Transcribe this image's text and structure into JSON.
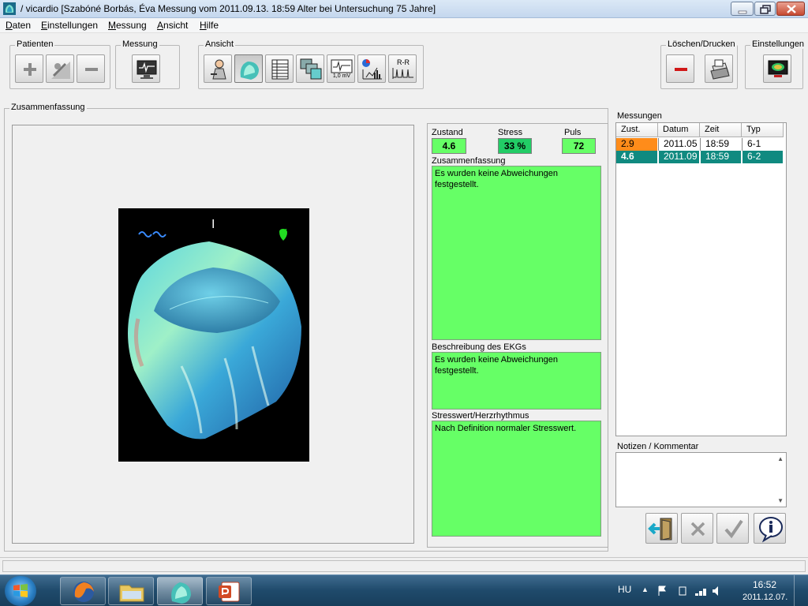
{
  "window": {
    "title": "/ vicardio [Szabóné Borbás, Éva Messung vom 2011.09.13. 18:59 Alter bei Untersuchung 75 Jahre]"
  },
  "menu": [
    "Daten",
    "Einstellungen",
    "Messung",
    "Ansicht",
    "Hilfe"
  ],
  "toolbar": {
    "patienten": {
      "label": "Patienten",
      "buttons": [
        "add-patient",
        "edit-patient",
        "remove-patient"
      ]
    },
    "messung": {
      "label": "Messung",
      "buttons": [
        "ecg-monitor"
      ]
    },
    "ansicht": {
      "label": "Ansicht",
      "buttons": [
        "patient-view",
        "3d-heart-view",
        "table-view",
        "multi-view",
        "ecg-1mv-view",
        "chart-view",
        "rr-interval-view"
      ],
      "ecg_scale": "1,0 mV",
      "rr_label": "R-R"
    },
    "loeschen": {
      "label": "Löschen/Drucken",
      "buttons": [
        "delete",
        "print"
      ]
    },
    "einstellungen": {
      "label": "Einstellungen",
      "buttons": [
        "monitor-settings"
      ]
    }
  },
  "main": {
    "section_label": "Zusammenfassung",
    "viz_marker": "I",
    "zustand_label": "Zustand",
    "zustand_value": "4.6",
    "stress_label": "Stress",
    "stress_value": "33 %",
    "puls_label": "Puls",
    "puls_value": "72",
    "summary_label": "Zusammenfassung",
    "summary_text": "Es wurden keine Abweichungen festgestellt.",
    "ekg_label": "Beschreibung des EKGs",
    "ekg_text": "Es wurden keine Abweichungen festgestellt.",
    "stress_rhythm_label": "Stresswert/Herzrhythmus",
    "stress_rhythm_text": "Nach Definition normaler Stresswert."
  },
  "measurements": {
    "label": "Messungen",
    "columns": [
      "Zust.",
      "Datum",
      "Zeit",
      "Typ"
    ],
    "rows": [
      {
        "zust": "2.9",
        "datum": "2011.05",
        "zeit": "18:59",
        "typ": "6-1"
      },
      {
        "zust": "4.6",
        "datum": "2011.09",
        "zeit": "18:59",
        "typ": "6-2"
      }
    ],
    "notes_label": "Notizen / Kommentar"
  },
  "colors": {
    "green_panel": "#66ff66",
    "stress_box": "#22cc66",
    "row1_zust": "#ff8c1a",
    "row2_selected": "#108a80"
  },
  "taskbar": {
    "lang": "HU",
    "time": "16:52",
    "date": "2011.12.07.",
    "apps": [
      "firefox",
      "explorer",
      "vicardio",
      "powerpoint"
    ]
  }
}
